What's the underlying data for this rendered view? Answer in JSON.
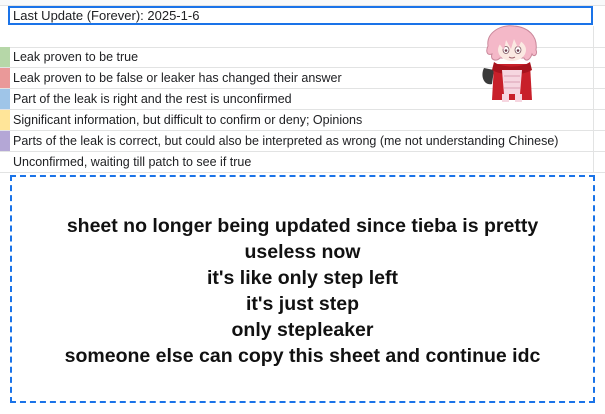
{
  "sheet": {
    "title": "Last Update (Forever): 2025-1-6"
  },
  "legend": [
    {
      "color": "#b6d7a8",
      "label": "Leak proven to be true"
    },
    {
      "color": "#ea9999",
      "label": "Leak proven to be false or leaker has changed their answer"
    },
    {
      "color": "#9fc5e8",
      "label": "Part of the leak is right and the rest is unconfirmed"
    },
    {
      "color": "#ffe599",
      "label": "Significant information, but difficult to confirm or deny; Opinions"
    },
    {
      "color": "#b4a7d6",
      "label": "Parts of the leak is correct, but could also be interpreted as wrong (me not understanding Chinese)"
    },
    {
      "color": "#ffffff",
      "label": "Unconfirmed, waiting till patch to see if true"
    }
  ],
  "note": {
    "lines": [
      "sheet no longer being updated since tieba is pretty",
      "useless now",
      "it's like only step left",
      "it's just step",
      "only stepleaker",
      "someone else can copy this sheet and continue idc"
    ]
  },
  "image": {
    "icon": "chibi-character-sticker",
    "colors": {
      "hair": "#f4b8c8",
      "scarf": "#c8202a",
      "coat": "#3a3a3a"
    }
  }
}
